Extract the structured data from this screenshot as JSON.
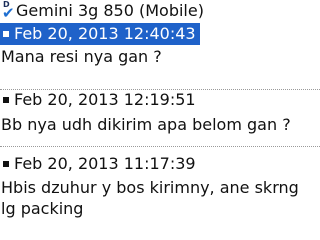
{
  "header": {
    "contact_title": "Gemini 3g 850 (Mobile)"
  },
  "messages": [
    {
      "timestamp": "Feb 20, 2013 12:40:43",
      "text": "Mana resi nya gan ?"
    },
    {
      "timestamp": "Feb 20, 2013 12:19:51",
      "text": "Bb nya udh dikirim apa belom gan ?"
    },
    {
      "timestamp": "Feb 20, 2013 11:17:39",
      "text": "Hbis dzuhur y bos kirimny, ane skrng lg packing"
    }
  ]
}
